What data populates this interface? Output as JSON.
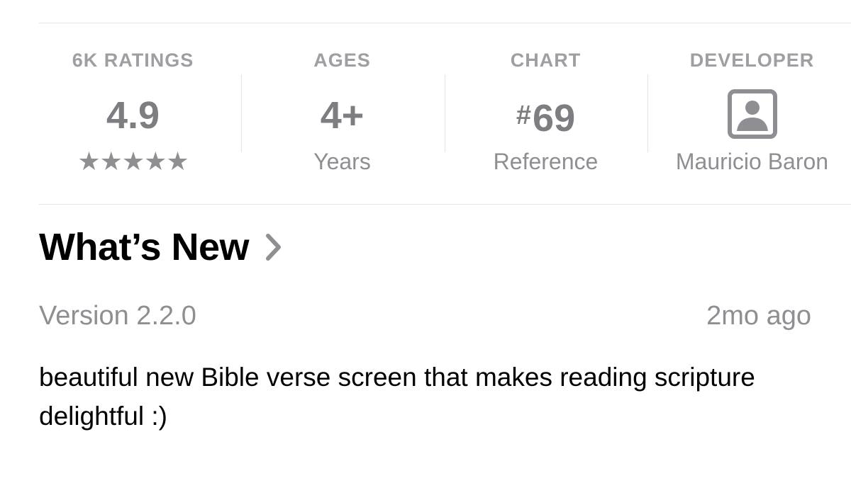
{
  "info": {
    "ratings": {
      "label": "6K RATINGS",
      "value": "4.9",
      "stars": "★★★★★"
    },
    "ages": {
      "label": "AGES",
      "value": "4+",
      "sub": "Years"
    },
    "chart": {
      "label": "CHART",
      "hash": "#",
      "value": "69",
      "sub": "Reference"
    },
    "developer": {
      "label": "DEVELOPER",
      "icon": "person-square-icon",
      "sub": "Mauricio Baron"
    }
  },
  "whats_new": {
    "title": "What’s New",
    "version": "Version 2.2.0",
    "date": "2mo ago",
    "notes": "beautiful new Bible verse screen that makes reading scripture delightful :)"
  },
  "colors": {
    "label_gray": "#8e8e93",
    "value_gray": "#7d7d82",
    "divider": "#e4e4e6"
  }
}
